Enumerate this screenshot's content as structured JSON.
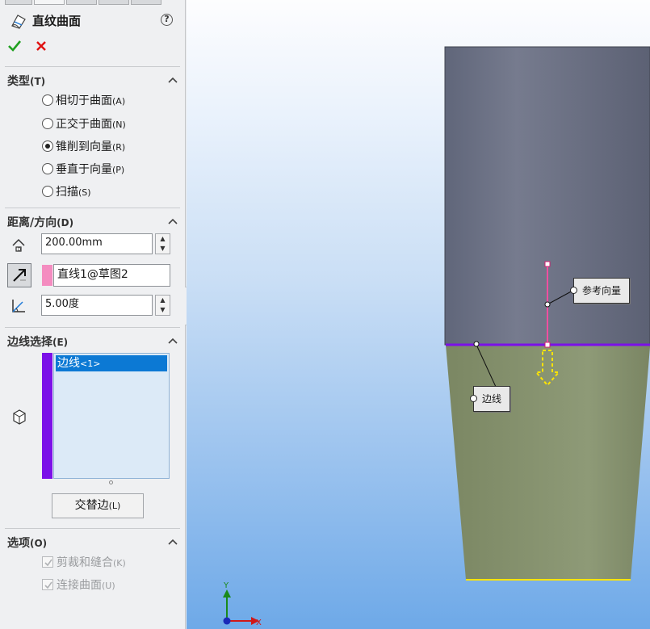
{
  "feature": {
    "title": "直纹曲面",
    "help_label": "?",
    "icon": "ruled-surface-icon"
  },
  "actions": {
    "ok_icon": "check-icon",
    "cancel_icon": "x-icon"
  },
  "type_section": {
    "heading": "类型",
    "key": "(T)",
    "options": [
      {
        "label": "相切于曲面",
        "key": "(A)",
        "selected": false
      },
      {
        "label": "正交于曲面",
        "key": "(N)",
        "selected": false
      },
      {
        "label": "锥削到向量",
        "key": "(R)",
        "selected": true
      },
      {
        "label": "垂直于向量",
        "key": "(P)",
        "selected": false
      },
      {
        "label": "扫描",
        "key": "(S)",
        "selected": false
      }
    ]
  },
  "distance_section": {
    "heading": "距离/方向",
    "key": "(D)",
    "distance_value": "200.00mm",
    "direction_reference": "直线1@草图2",
    "angle_value": "5.00度",
    "reference_color": "#f48cc0"
  },
  "edge_section": {
    "heading": "边线选择",
    "key": "(E)",
    "items": [
      {
        "label": "边线",
        "suffix": "<1>"
      }
    ],
    "alternate_button": {
      "label": "交替边",
      "key": "(L)"
    },
    "list_color": "#7b10e8"
  },
  "options_section": {
    "heading": "选项",
    "key": "(O)",
    "checkboxes": [
      {
        "label": "剪裁和缝合",
        "key": "(K)",
        "checked": true,
        "enabled": false
      },
      {
        "label": "连接曲面",
        "key": "(U)",
        "checked": true,
        "enabled": false
      }
    ]
  },
  "viewport": {
    "callout_reference": "参考向量",
    "callout_edge": "边线",
    "triad_x": "X",
    "triad_y": "Y",
    "colors": {
      "block": "#6d7284",
      "surface": "#8e9a77",
      "edge": "#7b10e8",
      "vector": "#f24fa0",
      "arrow": "#ffe400"
    }
  }
}
